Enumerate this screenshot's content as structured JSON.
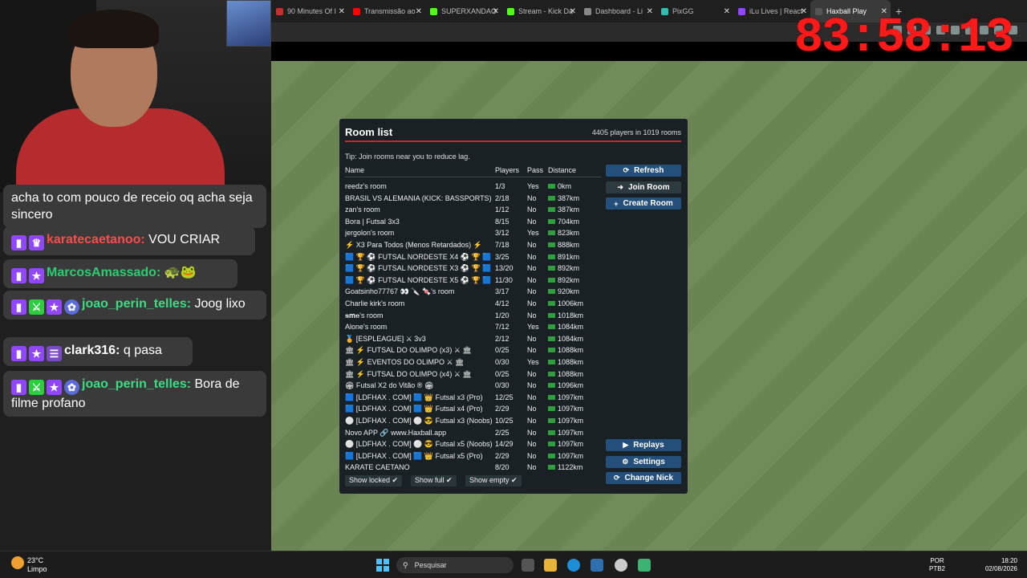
{
  "browser": {
    "tabs": [
      {
        "label": "90 Minutes Of I",
        "color": "#c4302b"
      },
      {
        "label": "Transmissão ao",
        "color": "#ff0000"
      },
      {
        "label": "SUPERXANDAO",
        "color": "#53fc18"
      },
      {
        "label": "Stream - Kick Da",
        "color": "#53fc18"
      },
      {
        "label": "Dashboard - Li",
        "color": "#888888"
      },
      {
        "label": "PixGG",
        "color": "#32bcad"
      },
      {
        "label": "iLu Lives | React",
        "color": "#9146ff"
      },
      {
        "label": "Haxball Play",
        "color": "#555555"
      }
    ],
    "active_tab_index": 7,
    "new_tab_symbol": "+"
  },
  "overlay": {
    "timer": "83:58:13"
  },
  "chat": {
    "partial_message": "acha to com pouco de receio oq acha seja sincero",
    "messages": [
      {
        "badges": [
          "twitch",
          "crown"
        ],
        "user": "karatecaetanoo",
        "user_color": "#ff4b4b",
        "text": "VOU CRIAR"
      },
      {
        "badges": [
          "twitch",
          "star"
        ],
        "user": "MarcosAmassado",
        "user_color": "#2ecc71",
        "text": "🐢🐸"
      },
      {
        "badges": [
          "twitch",
          "green",
          "star",
          "flower"
        ],
        "user": "joao_perin_telles",
        "user_color": "#3ddc84",
        "text": "Joog lixo"
      },
      {
        "badges": [
          "twitch",
          "star",
          "rail"
        ],
        "user": "clark316",
        "user_color": "#ffffff",
        "text": "q pasa"
      },
      {
        "badges": [
          "twitch",
          "green",
          "star",
          "flower"
        ],
        "user": "joao_perin_telles",
        "user_color": "#3ddc84",
        "text": "Bora de filme profano"
      }
    ]
  },
  "room_list": {
    "title": "Room list",
    "count": "4405 players in 1019 rooms",
    "tip": "Tip: Join rooms near you to reduce lag.",
    "columns": {
      "name": "Name",
      "players": "Players",
      "pass": "Pass",
      "distance": "Distance"
    },
    "rooms": [
      {
        "name": "reedz's room",
        "players": "1/3",
        "pass": "Yes",
        "distance": "0km"
      },
      {
        "name": "BRASIL VS ALEMANIA (KICK: BASSPORTS)",
        "players": "2/18",
        "pass": "No",
        "distance": "387km"
      },
      {
        "name": "zan's room",
        "players": "1/12",
        "pass": "No",
        "distance": "387km"
      },
      {
        "name": "Bora | Futsal 3x3",
        "players": "8/15",
        "pass": "No",
        "distance": "704km"
      },
      {
        "name": "jergolon's room",
        "players": "3/12",
        "pass": "Yes",
        "distance": "823km"
      },
      {
        "name": "⚡ X3 Para Todos (Menos Retardados) ⚡",
        "players": "7/18",
        "pass": "No",
        "distance": "888km"
      },
      {
        "name": "🟦 🏆 ⚽ FUTSAL NORDESTE X4 ⚽ 🏆 🟦",
        "players": "3/25",
        "pass": "No",
        "distance": "891km"
      },
      {
        "name": "🟦 🏆 ⚽ FUTSAL NORDESTE X3 ⚽ 🏆 🟦",
        "players": "13/20",
        "pass": "No",
        "distance": "892km"
      },
      {
        "name": "🟦 🏆 ⚽ FUTSAL NORDESTE X5 ⚽ 🏆 🟦",
        "players": "11/30",
        "pass": "No",
        "distance": "892km"
      },
      {
        "name": "Goatsinho77767 👀 🔪 🍬's room",
        "players": "3/17",
        "pass": "No",
        "distance": "920km"
      },
      {
        "name": "Charlie kirk's room",
        "players": "4/12",
        "pass": "No",
        "distance": "1006km"
      },
      {
        "name": "𝐬𝐦𝐞's room",
        "players": "1/20",
        "pass": "No",
        "distance": "1018km"
      },
      {
        "name": "Alone's room",
        "players": "7/12",
        "pass": "Yes",
        "distance": "1084km"
      },
      {
        "name": "🏅 [ESPLEAGUE] ⚔ 3v3",
        "players": "2/12",
        "pass": "No",
        "distance": "1084km"
      },
      {
        "name": "🏛 ⚡ FUTSAL DO OLIMPO (x3) ⚔ 🏛",
        "players": "0/25",
        "pass": "No",
        "distance": "1088km"
      },
      {
        "name": "🏛 ⚡ EVENTOS DO OLIMPO ⚔ 🏛",
        "players": "0/30",
        "pass": "Yes",
        "distance": "1088km"
      },
      {
        "name": "🏛 ⚡ FUTSAL DO OLIMPO (x4) ⚔ 🏛",
        "players": "0/25",
        "pass": "No",
        "distance": "1088km"
      },
      {
        "name": "🏟 Futsal X2 do Vitão ® 🏟",
        "players": "0/30",
        "pass": "No",
        "distance": "1096km"
      },
      {
        "name": "🟦 [LDFHAX . COM] 🟦 👑 Futsal x3 (Pro)",
        "players": "12/25",
        "pass": "No",
        "distance": "1097km"
      },
      {
        "name": "🟦 [LDFHAX . COM] 🟦 👑 Futsal x4 (Pro)",
        "players": "2/29",
        "pass": "No",
        "distance": "1097km"
      },
      {
        "name": "⚪ [LDFHAX . COM] ⚪ 😎 Futsal x3 (Noobs)",
        "players": "10/25",
        "pass": "No",
        "distance": "1097km"
      },
      {
        "name": "     Novo APP   🔗   www.Haxball.app",
        "players": "2/25",
        "pass": "No",
        "distance": "1097km"
      },
      {
        "name": "⚪ [LDFHAX . COM] ⚪ 😎 Futsal x5 (Noobs)",
        "players": "14/29",
        "pass": "No",
        "distance": "1097km"
      },
      {
        "name": "🟦 [LDFHAX . COM] 🟦 👑 Futsal x5 (Pro)",
        "players": "2/29",
        "pass": "No",
        "distance": "1097km"
      },
      {
        "name": "KARATE CAETANO",
        "players": "8/20",
        "pass": "No",
        "distance": "1122km"
      }
    ],
    "buttons": {
      "refresh": "Refresh",
      "join": "Join Room",
      "create": "Create Room",
      "replays": "Replays",
      "settings": "Settings",
      "change_nick": "Change Nick"
    },
    "filters": {
      "locked": "Show locked ✔",
      "full": "Show full ✔",
      "empty": "Show empty ✔"
    }
  },
  "taskbar": {
    "weather_temp": "23°C",
    "weather_desc": "Limpo",
    "search_placeholder": "Pesquisar",
    "lang_top": "POR",
    "lang_bottom": "PTB2",
    "time": "18:20",
    "date": "02/08/2026"
  }
}
